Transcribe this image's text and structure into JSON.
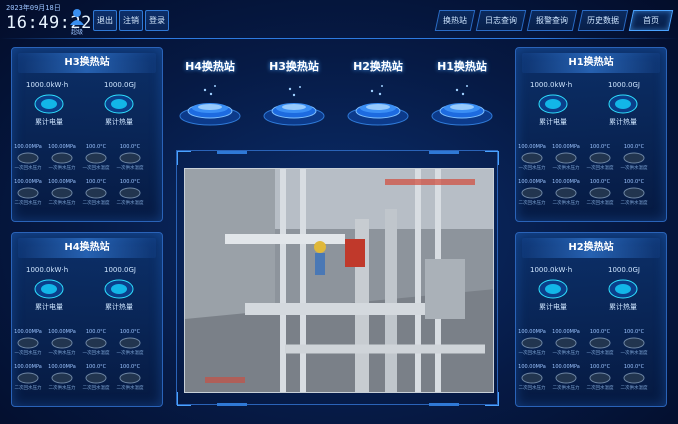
{
  "header": {
    "date": "2023年09月18日",
    "time": "16:49:22",
    "user_name": "超级",
    "buttons": [
      "登录",
      "注销",
      "退出"
    ],
    "nav": [
      "首页",
      "历史数据",
      "报警查询",
      "日志查询",
      "换热站"
    ],
    "active_nav_index": 0
  },
  "stations_center": [
    {
      "name": "H4换热站"
    },
    {
      "name": "H3换热站"
    },
    {
      "name": "H2换热站"
    },
    {
      "name": "H1换热站"
    }
  ],
  "panels": {
    "h1": {
      "title": "H1换热站",
      "total_flow": "1000.0GJ",
      "total_power": "1000.0kW·h",
      "label_heat": "累计热量",
      "label_power": "累计电量",
      "gauges": [
        {
          "value": "100.0°C",
          "label": "一次供水温度"
        },
        {
          "value": "100.0°C",
          "label": "一次回水温度"
        },
        {
          "value": "100.00MPa",
          "label": "一次供水压力"
        },
        {
          "value": "100.00MPa",
          "label": "一次回水压力"
        },
        {
          "value": "100.0°C",
          "label": "二次供水温度"
        },
        {
          "value": "100.0°C",
          "label": "二次回水温度"
        },
        {
          "value": "100.00MPa",
          "label": "二次供水压力"
        },
        {
          "value": "100.00MPa",
          "label": "二次回水压力"
        }
      ]
    },
    "h2": {
      "title": "H2换热站",
      "total_flow": "1000.0GJ",
      "total_power": "1000.0kW·h",
      "label_heat": "累计热量",
      "label_power": "累计电量",
      "gauges": [
        {
          "value": "100.0°C",
          "label": "一次供水温度"
        },
        {
          "value": "100.0°C",
          "label": "一次回水温度"
        },
        {
          "value": "100.00MPa",
          "label": "一次供水压力"
        },
        {
          "value": "100.00MPa",
          "label": "一次回水压力"
        },
        {
          "value": "100.0°C",
          "label": "二次供水温度"
        },
        {
          "value": "100.0°C",
          "label": "二次回水温度"
        },
        {
          "value": "100.00MPa",
          "label": "二次供水压力"
        },
        {
          "value": "100.00MPa",
          "label": "二次回水压力"
        }
      ]
    },
    "h3": {
      "title": "H3换热站",
      "total_flow": "1000.0GJ",
      "total_power": "1000.0kW·h",
      "label_heat": "累计热量",
      "label_power": "累计电量",
      "gauges": [
        {
          "value": "100.0°C",
          "label": "一次供水温度"
        },
        {
          "value": "100.0°C",
          "label": "一次回水温度"
        },
        {
          "value": "100.00MPa",
          "label": "一次供水压力"
        },
        {
          "value": "100.00MPa",
          "label": "一次回水压力"
        },
        {
          "value": "100.0°C",
          "label": "二次供水温度"
        },
        {
          "value": "100.0°C",
          "label": "二次回水温度"
        },
        {
          "value": "100.00MPa",
          "label": "二次供水压力"
        },
        {
          "value": "100.00MPa",
          "label": "二次回水压力"
        }
      ]
    },
    "h4": {
      "title": "H4换热站",
      "total_flow": "1000.0GJ",
      "total_power": "1000.0kW·h",
      "label_heat": "累计热量",
      "label_power": "累计电量",
      "gauges": [
        {
          "value": "100.0°C",
          "label": "一次供水温度"
        },
        {
          "value": "100.0°C",
          "label": "一次回水温度"
        },
        {
          "value": "100.00MPa",
          "label": "一次供水压力"
        },
        {
          "value": "100.00MPa",
          "label": "一次回水压力"
        },
        {
          "value": "100.0°C",
          "label": "二次供水温度"
        },
        {
          "value": "100.0°C",
          "label": "二次回水温度"
        },
        {
          "value": "100.00MPa",
          "label": "二次供水压力"
        },
        {
          "value": "100.00MPa",
          "label": "二次回水压力"
        }
      ]
    }
  },
  "colors": {
    "accent": "#2f79d6",
    "glow": "#4aa3ff",
    "background": "#061a45"
  }
}
